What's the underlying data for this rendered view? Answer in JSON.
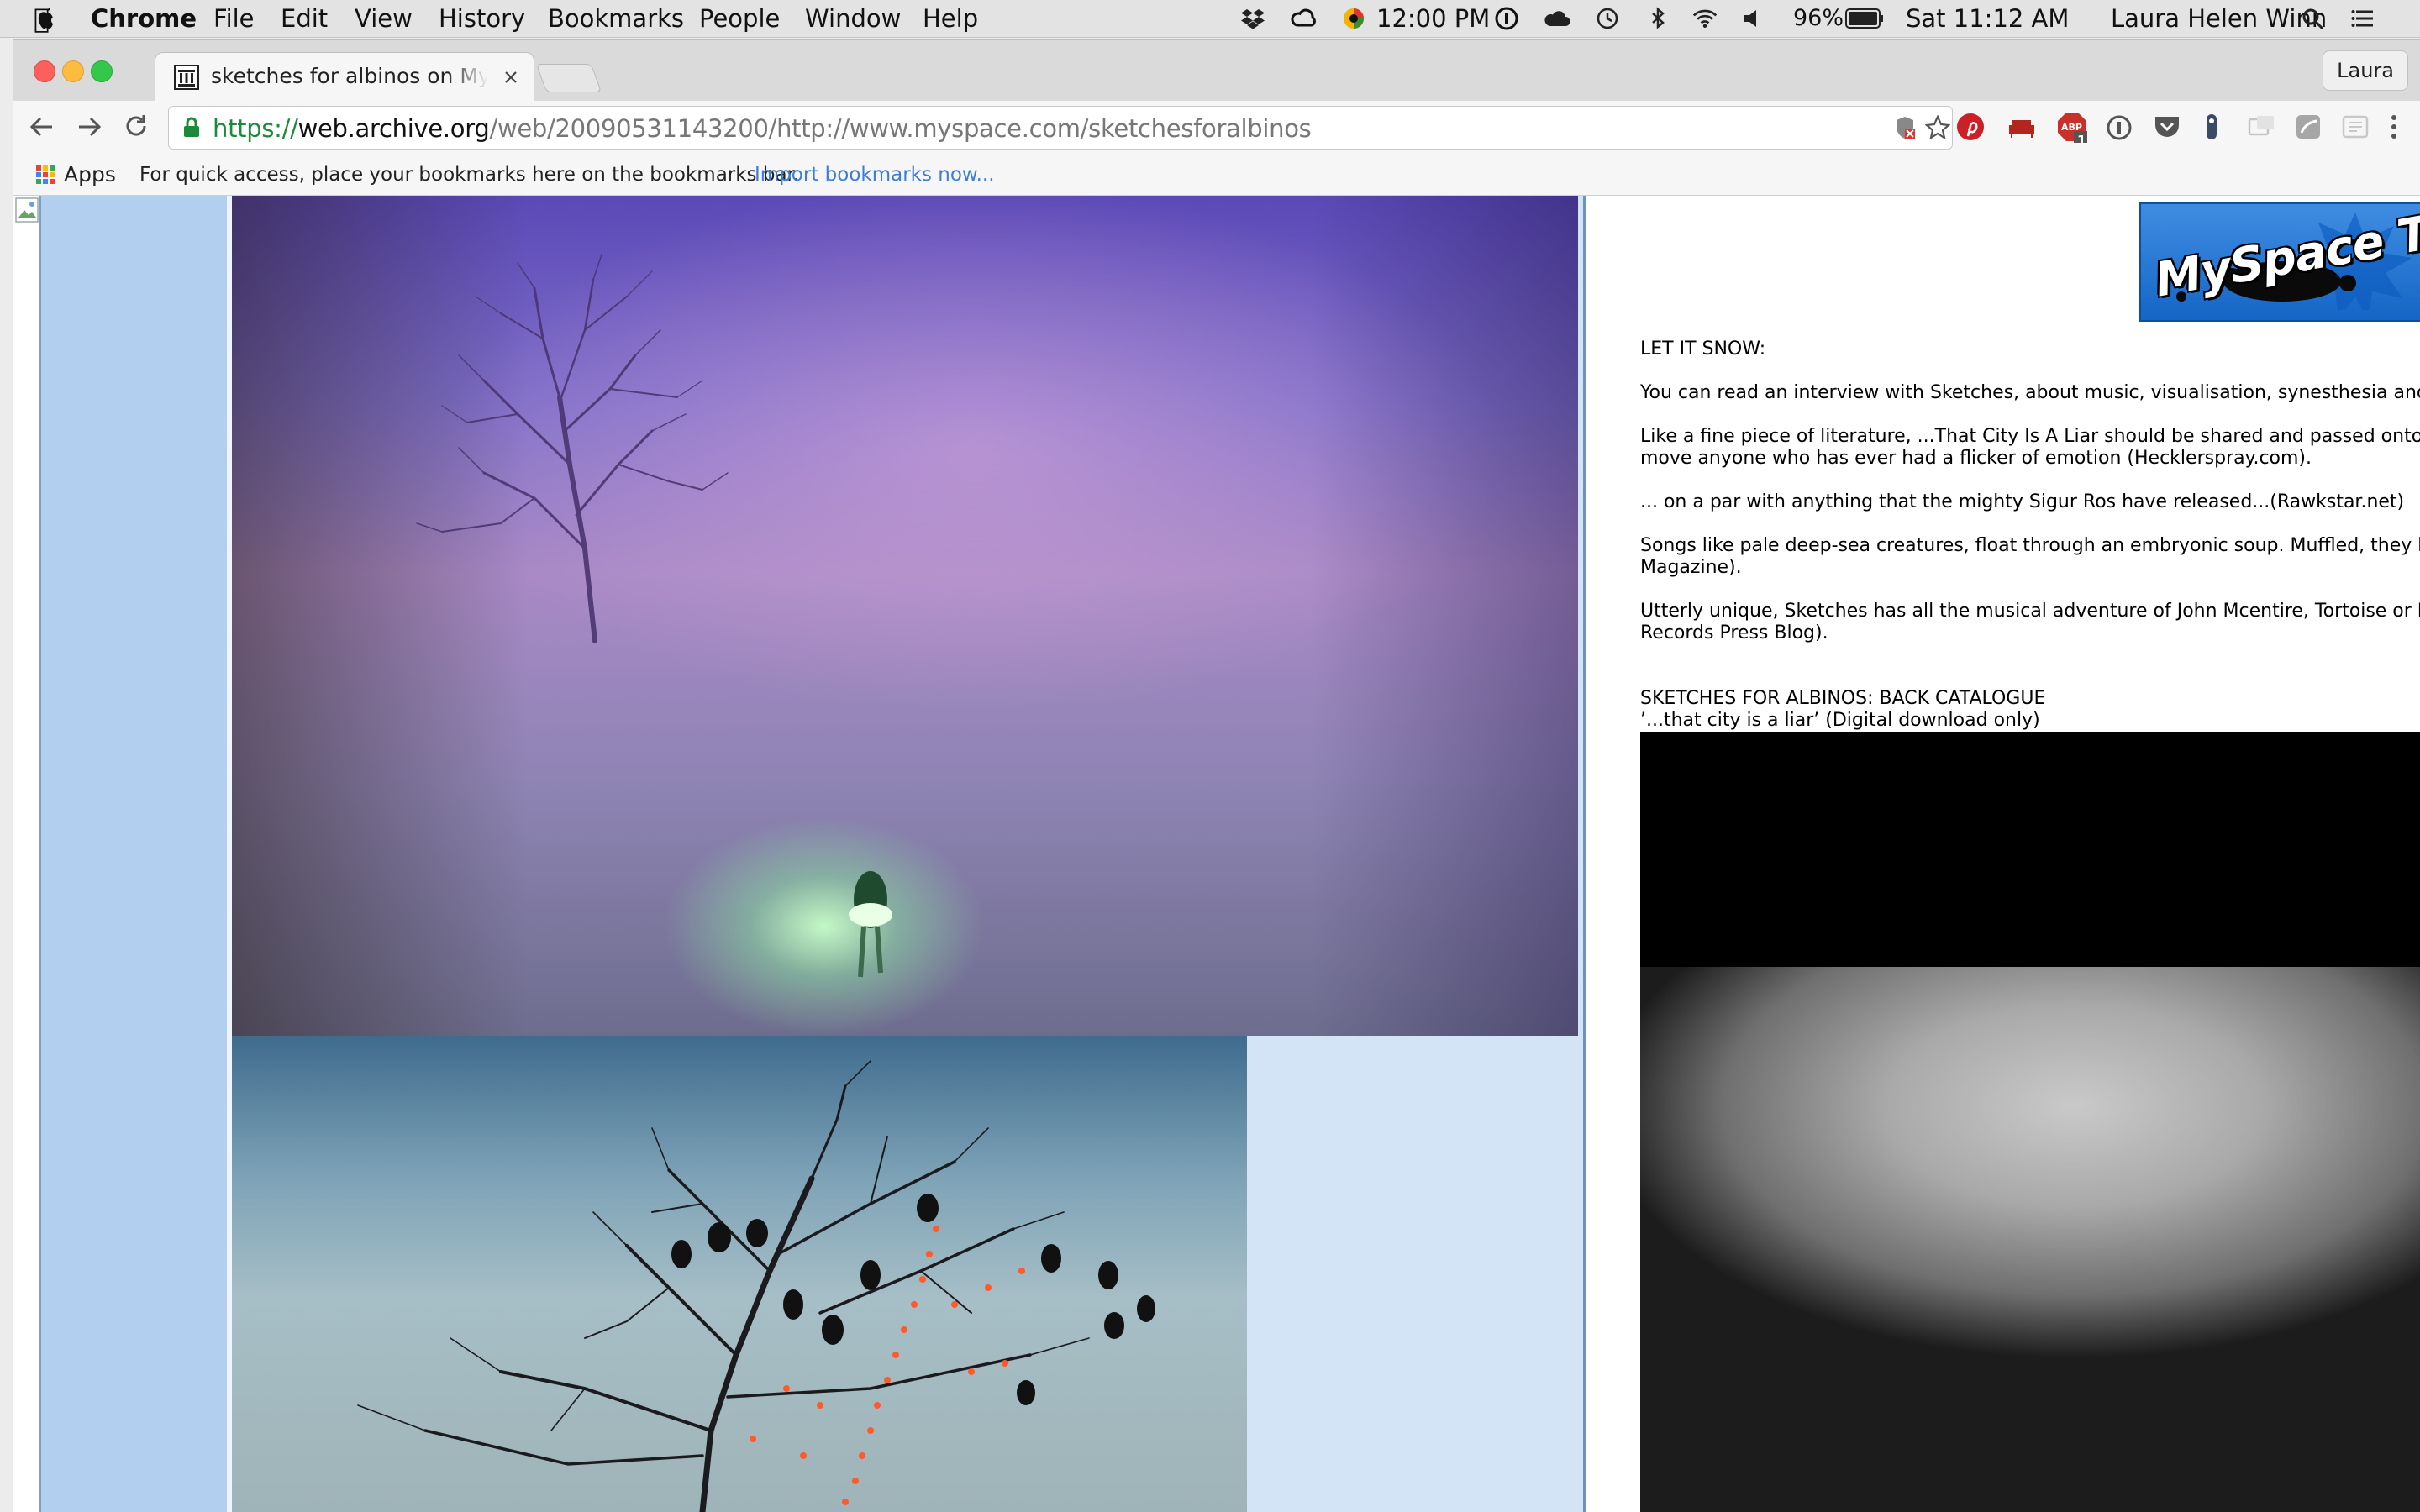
{
  "menubar": {
    "app_name": "Chrome",
    "menus": [
      "File",
      "Edit",
      "View",
      "History",
      "Bookmarks",
      "People",
      "Window",
      "Help"
    ],
    "clock_icon_time": "12:00 PM",
    "battery": "96%",
    "datetime": "Sat 11:12 AM",
    "user": "Laura Helen Winn"
  },
  "browser": {
    "tab_title": "sketches for albinos on MySpace",
    "profile_label": "Laura",
    "url_scheme": "https://",
    "url_host": "web.archive.org",
    "url_path": "/web/20090531143200/http://www.myspace.com/sketchesforalbinos",
    "bookmarks": {
      "apps_label": "Apps",
      "hint": "For quick access, place your bookmarks here on the bookmarks bar.",
      "import_link": "Import bookmarks now..."
    },
    "abp_count": "1"
  },
  "page": {
    "banner_text": "MySpace Toys",
    "heading": "LET IT SNOW:",
    "p1": "You can read an interview with Sketches, about music, visualisation, synesthesia and th",
    "p2a": "Like a fine piece of literature, ...That City Is A Liar should be shared and passed onto as",
    "p2b": "move anyone who has ever had a flicker of emotion (Hecklerspray.com).",
    "p3": "... on a par with anything that the mighty Sigur Ros have released...(Rawkstar.net)",
    "p4a": "Songs like pale deep-sea creatures, float through an embryonic soup. Muffled, they ben",
    "p4b": "Magazine).",
    "p5a": "Utterly unique, Sketches has all the musical adventure of John Mcentire, Tortoise or Kev",
    "p5b": "Records Press Blog).",
    "catalogue_heading": "SKETCHES FOR ALBINOS: BACK CATALOGUE",
    "catalogue_item": "’...that city is a liar’ (Digital download only)"
  },
  "colors": {
    "menubar_bg": "#e3e3e3",
    "left_strip": "#b2cff0",
    "photo_column_bg": "#d3e4f7",
    "divider": "#6f92b7",
    "link": "#3d7dd8",
    "secure_green": "#1b8a3a"
  }
}
